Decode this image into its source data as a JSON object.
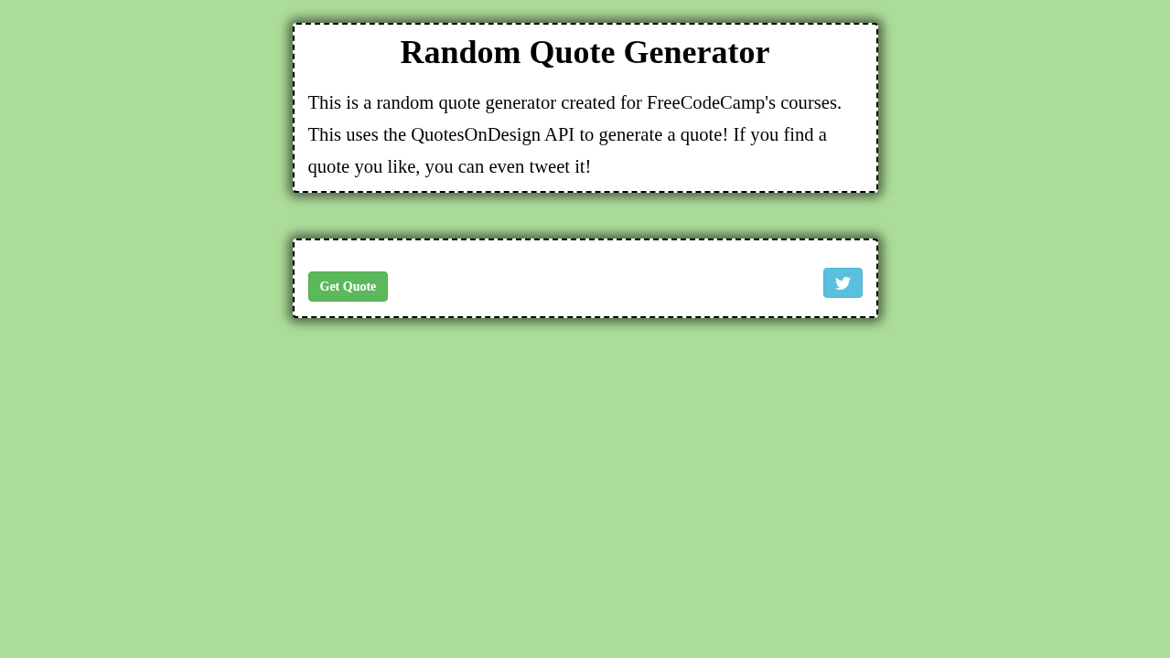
{
  "intro_card": {
    "title": "Random Quote Generator",
    "description": "This is a random quote generator created for FreeCodeCamp's courses. This uses the QuotesOnDesign API to generate a quote! If you find a quote you like, you can even tweet it!"
  },
  "quote_card": {
    "get_quote_button": {
      "label": "Get Quote"
    }
  }
}
